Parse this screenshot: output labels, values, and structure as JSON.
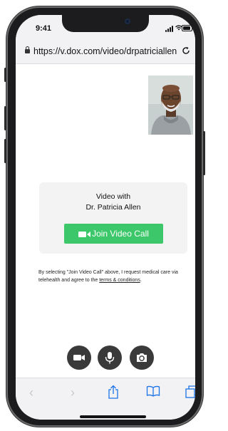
{
  "status": {
    "time": "9:41"
  },
  "browser": {
    "url": "https://v.dox.com/video/drpatriciallen"
  },
  "call": {
    "title_line1": "Video with",
    "title_line2": "Dr. Patricia Allen",
    "join_label": "Join Video Call"
  },
  "disclaimer": {
    "text": "By selecting \"Join Video Call\" above, I request medical care via telehealth and agree to the ",
    "link": "terms & conditions",
    "end": "."
  },
  "controls": [
    "video-camera-icon",
    "microphone-icon",
    "switch-camera-icon"
  ],
  "colors": {
    "accent_green": "#3cc86a",
    "control_dark": "#3a3a3a",
    "ios_blue": "#1a73e8"
  }
}
